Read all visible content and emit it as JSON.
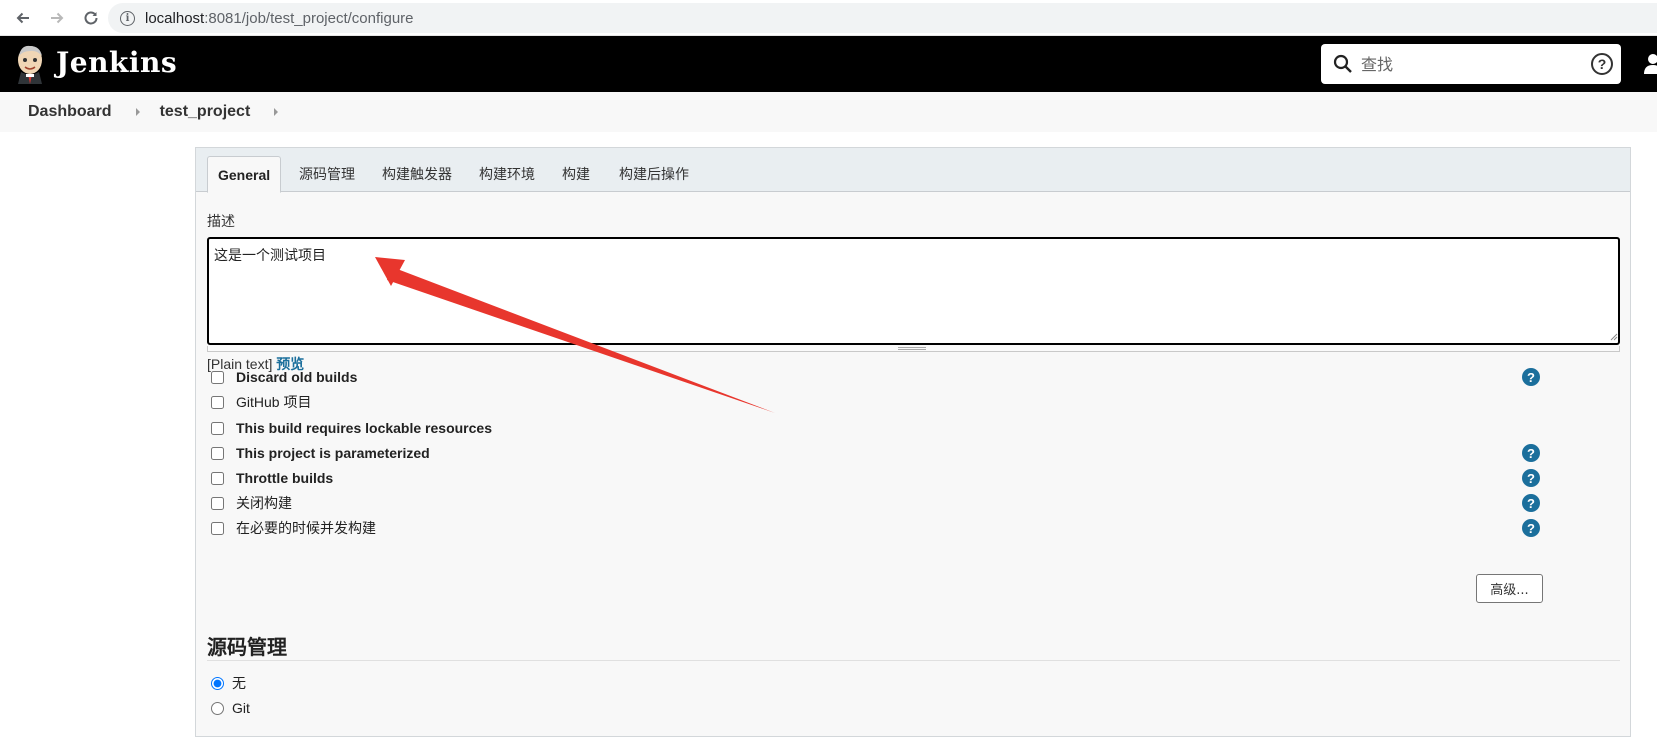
{
  "browser": {
    "url_host": "localhost",
    "url_path": ":8081/job/test_project/configure"
  },
  "header": {
    "brand": "Jenkins",
    "search_placeholder": "查找",
    "help_symbol": "?"
  },
  "breadcrumb": {
    "items": [
      "Dashboard",
      "test_project"
    ]
  },
  "tabs": [
    "General",
    "源码管理",
    "构建触发器",
    "构建环境",
    "构建",
    "构建后操作"
  ],
  "general": {
    "description_label": "描述",
    "description_value": "这是一个测试项目",
    "plain_text": "[Plain text]",
    "preview_link": "预览",
    "options": [
      {
        "label": "Discard old builds",
        "checked": false,
        "help": true
      },
      {
        "label": "GitHub 项目",
        "checked": false,
        "help": false
      },
      {
        "label": "This build requires lockable resources",
        "checked": false,
        "help": false
      },
      {
        "label": "This project is parameterized",
        "checked": false,
        "help": true
      },
      {
        "label": "Throttle builds",
        "checked": false,
        "help": true
      },
      {
        "label": "关闭构建",
        "checked": false,
        "help": true
      },
      {
        "label": "在必要的时候并发构建",
        "checked": false,
        "help": true
      }
    ],
    "advanced_button": "高级..."
  },
  "scm": {
    "title": "源码管理",
    "options": [
      {
        "label": "无",
        "checked": true
      },
      {
        "label": "Git",
        "checked": false
      }
    ]
  },
  "help_symbol": "?",
  "colors": {
    "header_bg": "#000000",
    "link_blue": "#1b6f9c",
    "arrow_red": "#e8362d"
  }
}
